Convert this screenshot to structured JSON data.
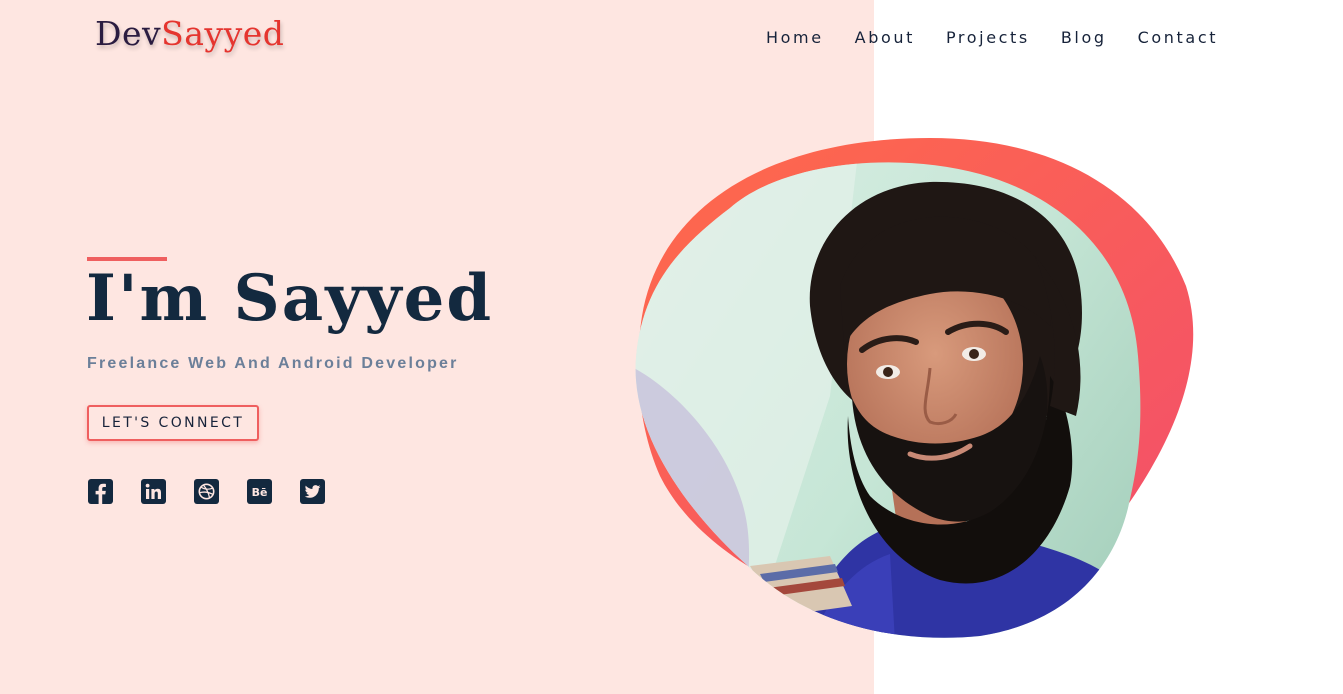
{
  "brand": {
    "part1": "Dev",
    "part2": "Sayyed"
  },
  "nav": {
    "items": [
      "Home",
      "About",
      "Projects",
      "Blog",
      "Contact"
    ]
  },
  "hero": {
    "title": "I'm Sayyed",
    "subtitle": "Freelance Web And Android Developer",
    "cta_label": "LET'S CONNECT",
    "socials": [
      {
        "icon": "facebook-icon",
        "letter": "f"
      },
      {
        "icon": "linkedin-icon",
        "letter": "in"
      },
      {
        "icon": "dribbble-icon",
        "letter": ""
      },
      {
        "icon": "behance-icon",
        "letter": "Bē"
      },
      {
        "icon": "twitter-icon",
        "letter": ""
      }
    ]
  },
  "colors": {
    "bg_pink": "#fee6e1",
    "navy": "#13293f",
    "accent_red": "#e5352f",
    "coral": "#ef5f5f",
    "muted_blue": "#6b7f99",
    "blob_gradient_start": "#ff6a4a",
    "blob_gradient_end": "#f24e6c"
  }
}
